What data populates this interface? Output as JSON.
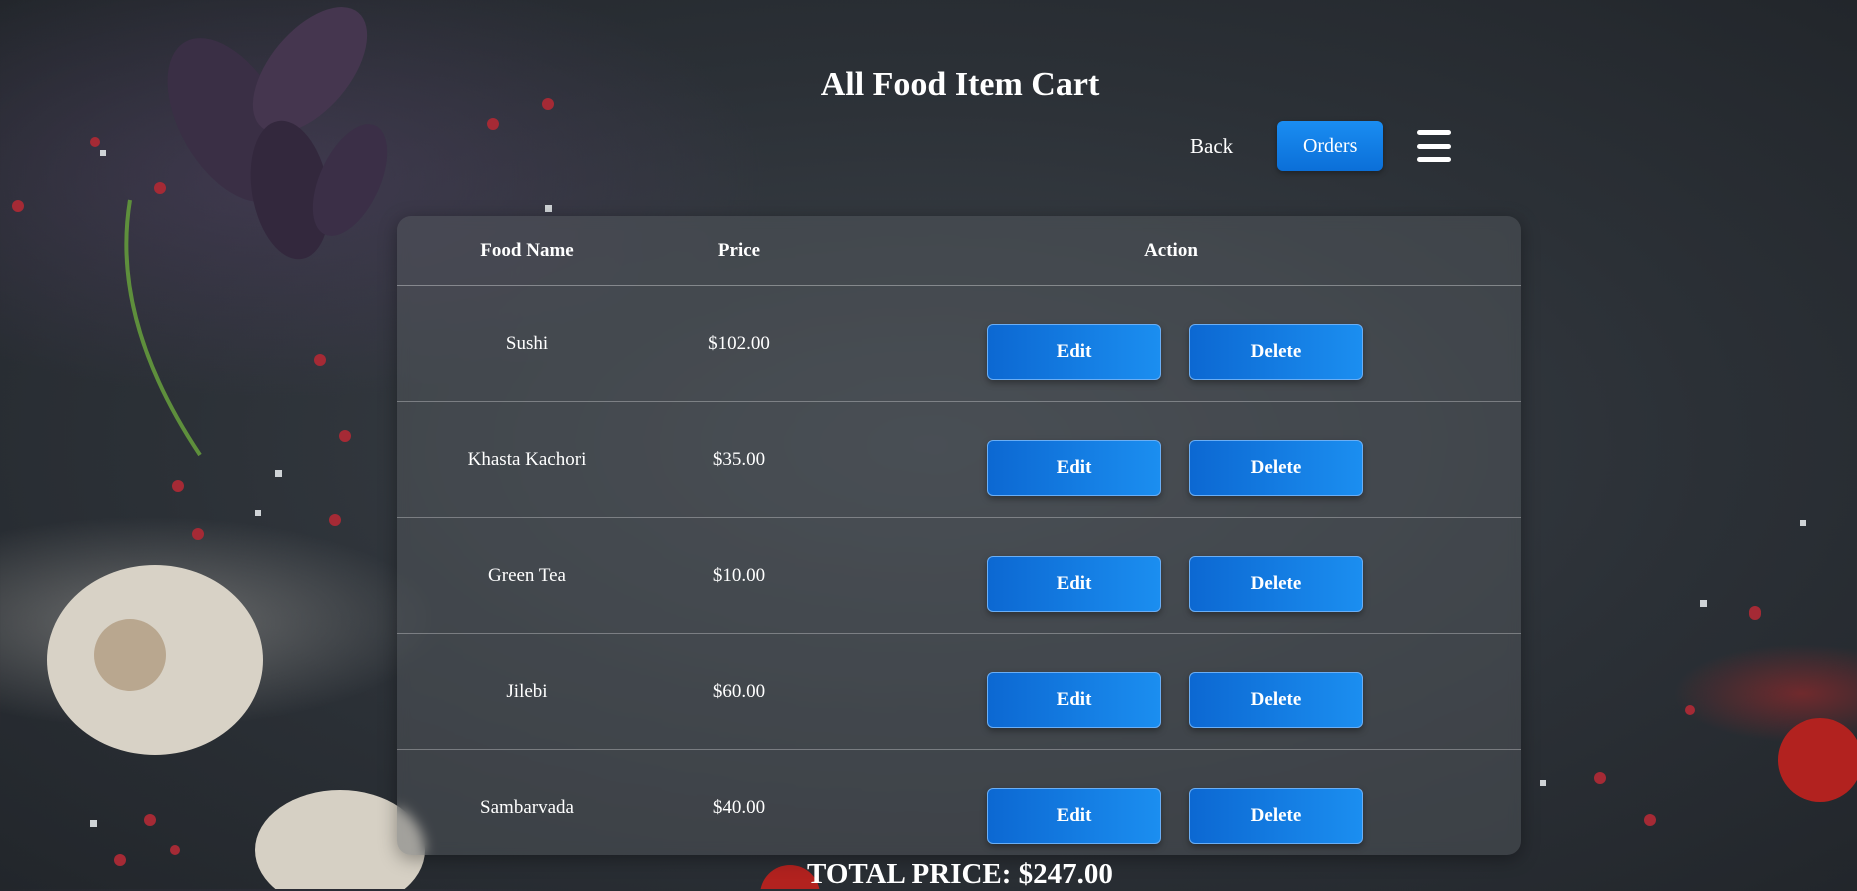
{
  "page": {
    "title": "All Food Item Cart"
  },
  "nav": {
    "back_label": "Back",
    "orders_label": "Orders",
    "menu_icon": "hamburger-menu-icon"
  },
  "table": {
    "headers": [
      "Food Name",
      "Price",
      "Action"
    ],
    "rows": [
      {
        "name": "Sushi",
        "price": "$102.00",
        "edit_label": "Edit",
        "delete_label": "Delete"
      },
      {
        "name": "Khasta Kachori",
        "price": "$35.00",
        "edit_label": "Edit",
        "delete_label": "Delete"
      },
      {
        "name": "Green Tea",
        "price": "$10.00",
        "edit_label": "Edit",
        "delete_label": "Delete"
      },
      {
        "name": "Jilebi",
        "price": "$60.00",
        "edit_label": "Edit",
        "delete_label": "Delete"
      },
      {
        "name": "Sambarvada",
        "price": "$40.00",
        "edit_label": "Edit",
        "delete_label": "Delete"
      }
    ]
  },
  "summary": {
    "total_text": "TOTAL PRICE: $247.00"
  },
  "colors": {
    "button_primary": "#1a8df2",
    "background": "#2b3036"
  }
}
